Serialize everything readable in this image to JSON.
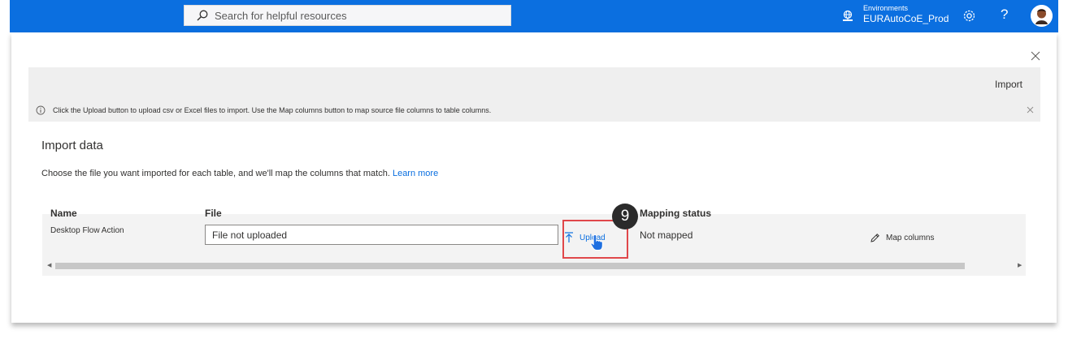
{
  "header": {
    "search_placeholder": "Search for helpful resources",
    "environment_label": "Environments",
    "environment_name": "EURAutoCoE_Prod",
    "help_glyph": "?",
    "brand_color": "#0b6fe0"
  },
  "command_bar": {
    "import_label": "Import"
  },
  "info_bar": {
    "message": "Click the Upload button to upload csv or Excel files to import. Use the Map columns button to map source file columns to table columns."
  },
  "import": {
    "title": "Import data",
    "description": "Choose the file you want imported for each table, and we'll map the columns that match.",
    "learn_more": "Learn more"
  },
  "table": {
    "columns": [
      "Name",
      "File",
      "Mapping status"
    ],
    "rows": [
      {
        "name": "Desktop Flow Action",
        "file_value": "File not uploaded",
        "upload_label": "Upload",
        "mapping_status": "Not mapped",
        "map_columns_label": "Map columns"
      }
    ]
  },
  "annotation": {
    "step_number": "9",
    "highlight_color": "#e0474a"
  }
}
